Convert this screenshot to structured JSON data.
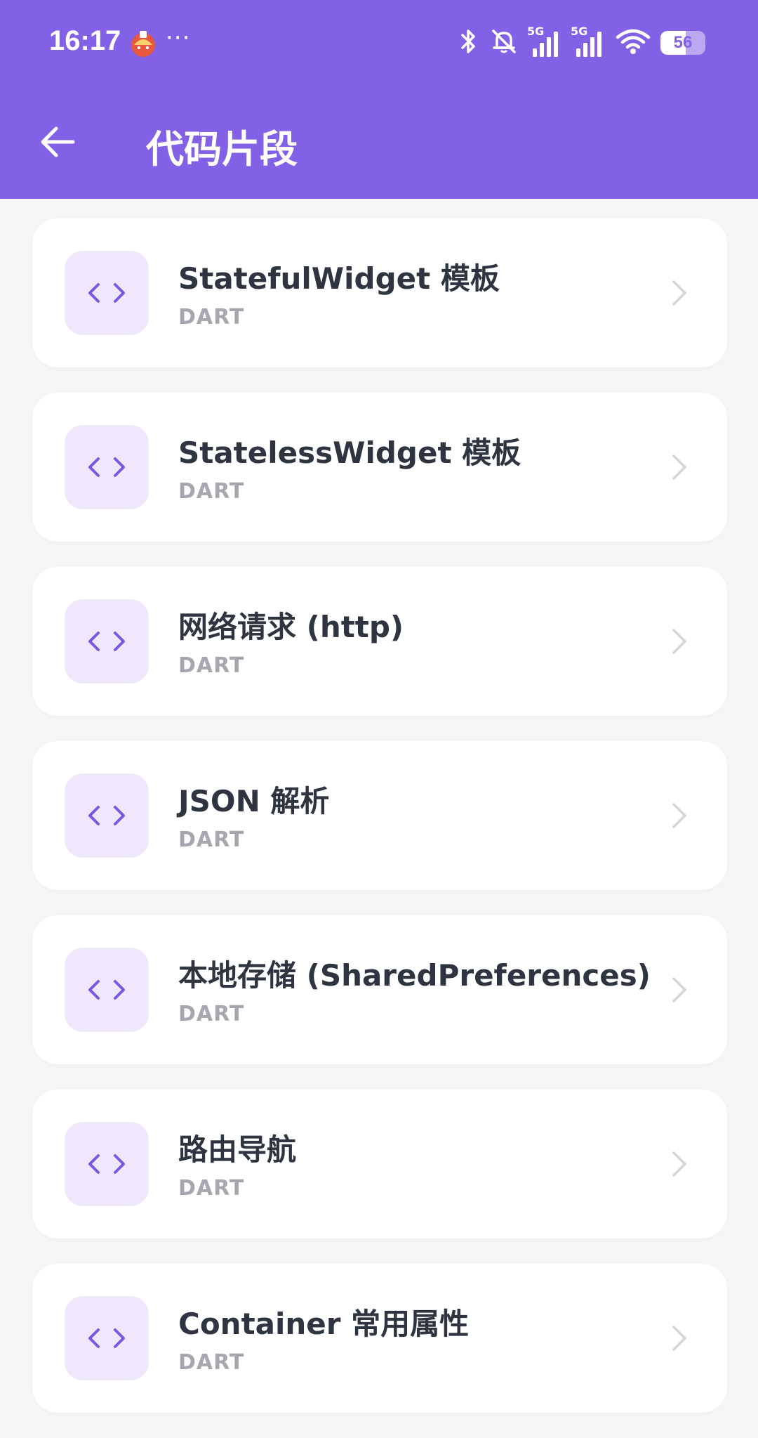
{
  "status_bar": {
    "time": "16:17",
    "more": "···",
    "network_1": "5G",
    "network_2": "5G",
    "battery_level": "56"
  },
  "header": {
    "title": "代码片段",
    "background": "#8361E7"
  },
  "snippets": [
    {
      "title": "StatefulWidget 模板",
      "lang": "DART"
    },
    {
      "title": "StatelessWidget 模板",
      "lang": "DART"
    },
    {
      "title": "网络请求 (http)",
      "lang": "DART"
    },
    {
      "title": "JSON 解析",
      "lang": "DART"
    },
    {
      "title": "本地存储 (SharedPreferences)",
      "lang": "DART"
    },
    {
      "title": "路由导航",
      "lang": "DART"
    },
    {
      "title": "Container 常用属性",
      "lang": "DART"
    }
  ],
  "colors": {
    "accent": "#8361E7",
    "icon_bg": "#EFE7FC",
    "icon_fg": "#7B57E4"
  }
}
